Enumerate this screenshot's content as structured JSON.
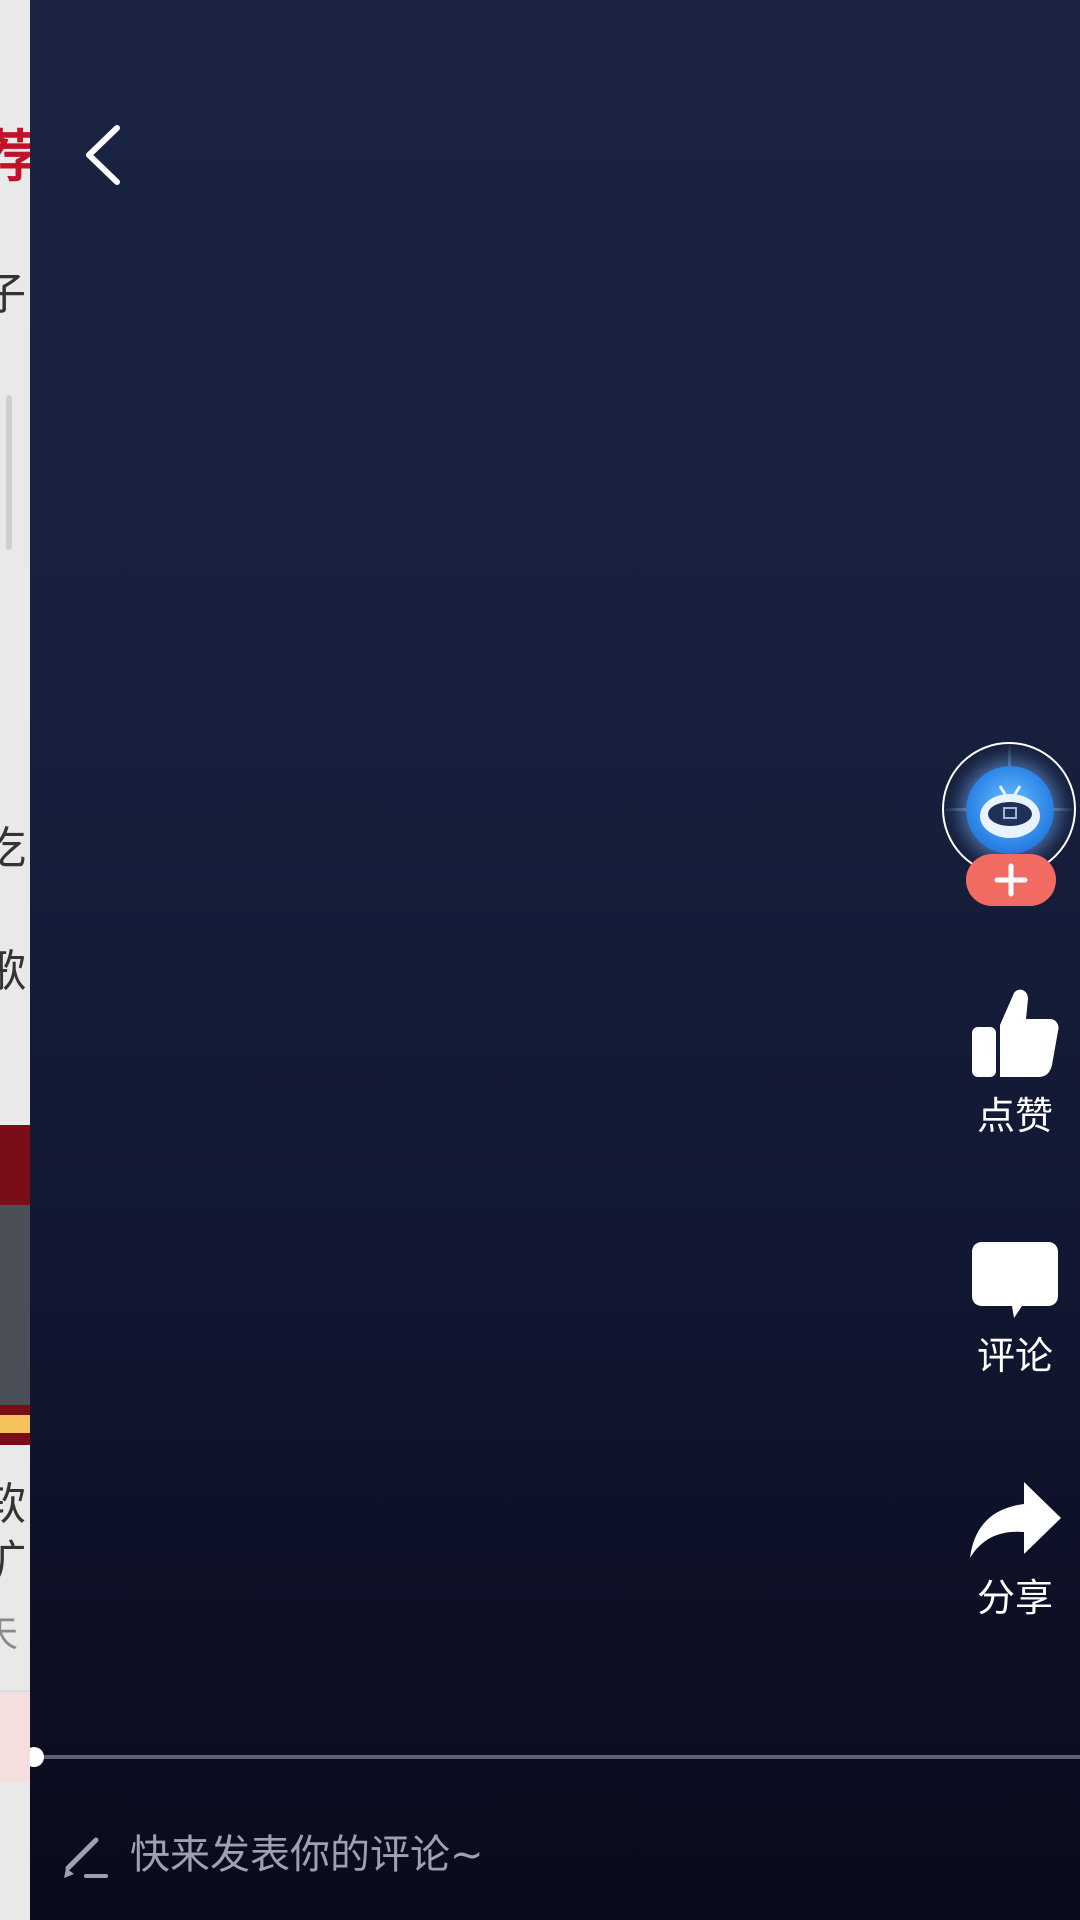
{
  "background_app": {
    "fragments": [
      "荐",
      "子",
      "吃",
      "歌",
      "软",
      "扩",
      "天"
    ]
  },
  "video": {
    "actions": {
      "like_label": "点赞",
      "comment_label": "评论",
      "share_label": "分享"
    },
    "progress": 0.0,
    "comment_placeholder": "快来发表你的评论~"
  },
  "colors": {
    "follow_button": "#f26b63",
    "background_top": "#1a2442",
    "background_bottom": "#0a0b1c"
  },
  "icons": [
    "back-arrow-icon",
    "thumbs-up-icon",
    "comment-bubble-icon",
    "share-arrow-icon",
    "pen-icon",
    "plus-icon"
  ]
}
